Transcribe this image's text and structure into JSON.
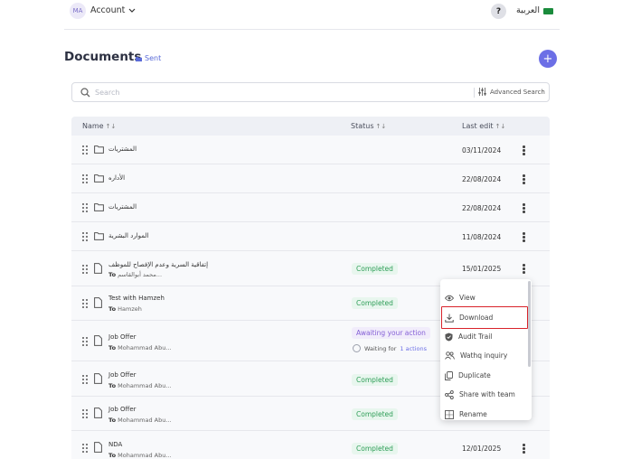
{
  "header": {
    "avatar_initials": "MA",
    "account_label": "Account",
    "help_label": "?",
    "language_label": "العربية"
  },
  "page": {
    "title": "Documents",
    "sent_label": "Sent",
    "add_label": "+"
  },
  "search": {
    "placeholder": "Search",
    "advanced_label": "Advanced Search"
  },
  "table": {
    "columns": {
      "name": "Name",
      "status": "Status",
      "last_edit": "Last edit",
      "sort_glyph": "↑↓"
    },
    "rows": [
      {
        "type": "folder",
        "name": "المشتريات",
        "date": "03/11/2024"
      },
      {
        "type": "folder",
        "name": "الأداره",
        "date": "22/08/2024"
      },
      {
        "type": "folder",
        "name": "المشتريات",
        "date": "22/08/2024"
      },
      {
        "type": "folder",
        "name": "الموارد البشرية",
        "date": "11/08/2024"
      },
      {
        "type": "file",
        "name": "إتفاقية السرية وعدم الإفصاح للموظف",
        "to_label": "To",
        "to": "محمد أبوالقاسم...",
        "status": "Completed",
        "date": "15/01/2025"
      },
      {
        "type": "file",
        "name": "Test with Hamzeh",
        "to_label": "To",
        "to": "Hamzeh",
        "status": "Completed"
      },
      {
        "type": "file",
        "name": "Job Offer",
        "to_label": "To",
        "to": "Mohammad Abu...",
        "status": "Awaiting your action",
        "waiting_label": "Waiting for",
        "waiting_link": "1 actions"
      },
      {
        "type": "file",
        "name": "Job Offer",
        "to_label": "To",
        "to": "Mohammad Abu...",
        "status": "Completed"
      },
      {
        "type": "file",
        "name": "Job Offer",
        "to_label": "To",
        "to": "Mohammad Abu...",
        "status": "Completed"
      },
      {
        "type": "file",
        "name": "NDA",
        "to_label": "To",
        "to": "Mohammad Abu...",
        "status": "Completed",
        "date": "12/01/2025"
      }
    ]
  },
  "context_menu": {
    "items": [
      {
        "label": "View",
        "icon": "eye-icon"
      },
      {
        "label": "Download",
        "icon": "download-icon",
        "highlighted": true
      },
      {
        "label": "Audit Trail",
        "icon": "shield-icon"
      },
      {
        "label": "Wathq inquiry",
        "icon": "users-icon"
      },
      {
        "label": "Duplicate",
        "icon": "copy-icon"
      },
      {
        "label": "Share with team",
        "icon": "share-icon"
      },
      {
        "label": "Rename",
        "icon": "rename-icon"
      }
    ]
  },
  "colors": {
    "accent": "#6c6fe6",
    "completed": "#2f9e58",
    "awaiting": "#8560d6",
    "highlight_border": "#d8232a",
    "flag_green": "#1a8b3c"
  }
}
